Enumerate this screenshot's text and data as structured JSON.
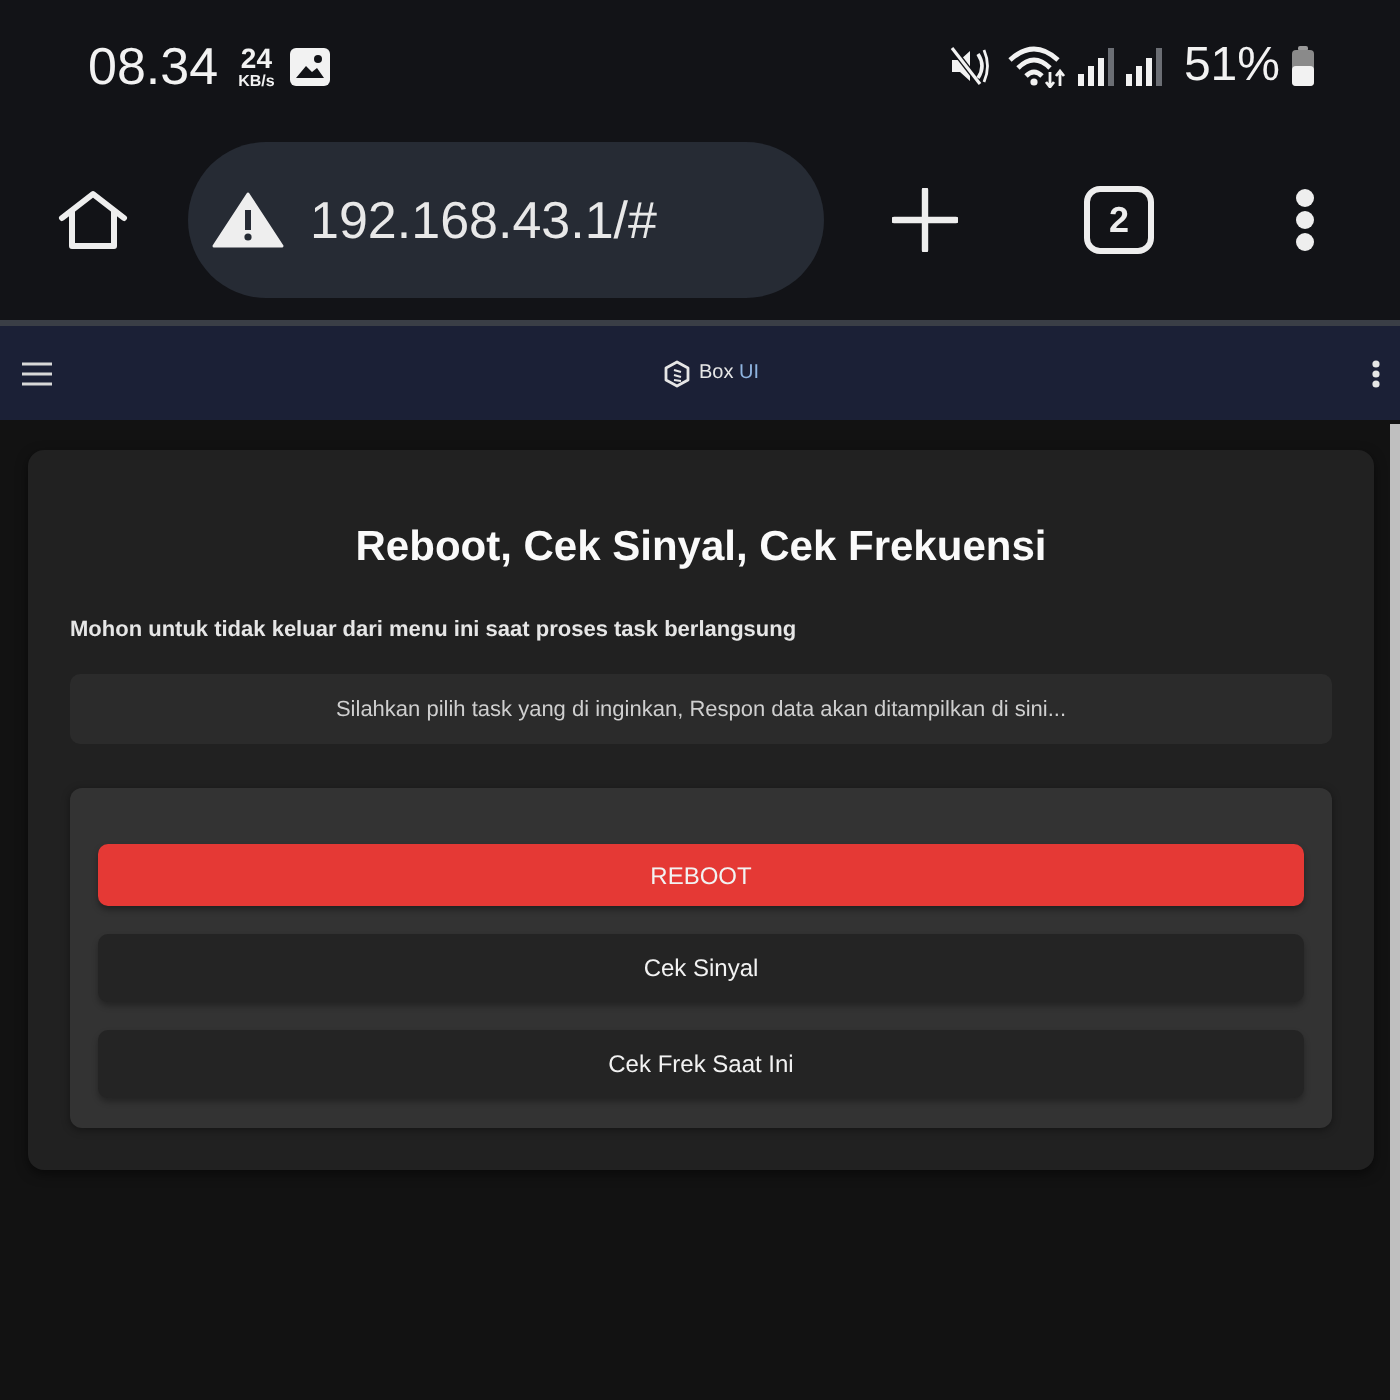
{
  "status_bar": {
    "time": "08.34",
    "speed_value": "24",
    "speed_unit": "KB/s",
    "battery": "51%"
  },
  "browser_bar": {
    "url": "192.168.43.1/#",
    "tab_count": "2"
  },
  "navbar": {
    "brand": "Box",
    "brand_suffix": "UI"
  },
  "card": {
    "title": "Reboot, Cek Sinyal, Cek Frekuensi",
    "warning": "Mohon untuk tidak keluar dari menu ini saat proses task berlangsung",
    "response": "Silahkan pilih task yang di inginkan, Respon data akan ditampilkan di sini...",
    "buttons": [
      {
        "label": "REBOOT",
        "kind": "danger"
      },
      {
        "label": "Cek Sinyal",
        "kind": "default"
      },
      {
        "label": "Cek Frek Saat Ini",
        "kind": "default"
      }
    ]
  }
}
